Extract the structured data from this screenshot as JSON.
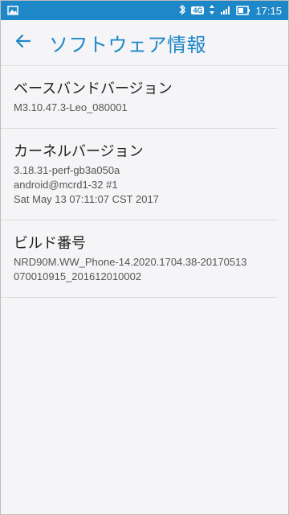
{
  "statusbar": {
    "time": "17:15",
    "network_badge": "4G",
    "icons": [
      "image-icon",
      "bluetooth-icon",
      "data-arrows-icon",
      "signal-icon",
      "battery-icon"
    ]
  },
  "appbar": {
    "title": "ソフトウェア情報",
    "back_icon": "back-arrow-icon"
  },
  "items": [
    {
      "title": "ベースバンドバージョン",
      "lines": [
        "M3.10.47.3-Leo_080001"
      ]
    },
    {
      "title": "カーネルバージョン",
      "lines": [
        "3.18.31-perf-gb3a050a",
        "android@mcrd1-32 #1",
        "Sat May 13 07:11:07 CST 2017"
      ]
    },
    {
      "title": "ビルド番号",
      "lines": [
        "NRD90M.WW_Phone-14.2020.1704.38-20170513",
        "070010915_201612010002"
      ]
    }
  ],
  "colors": {
    "accent": "#1e87c8",
    "background": "#f5f5f7"
  }
}
